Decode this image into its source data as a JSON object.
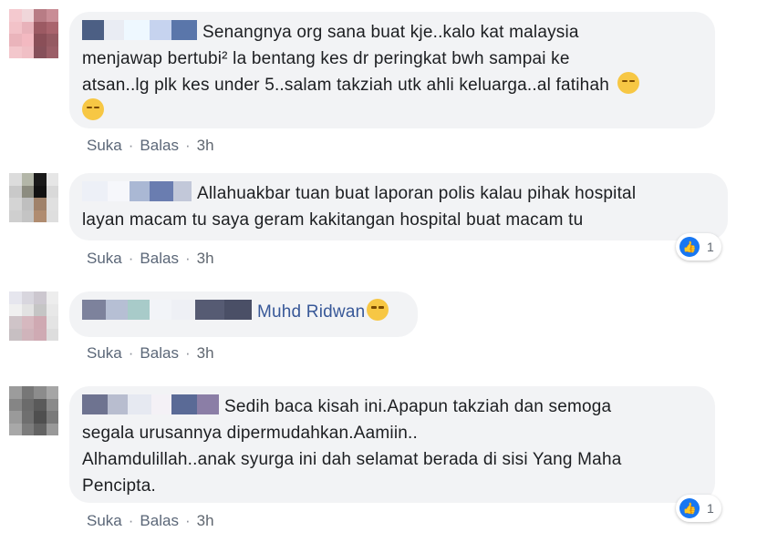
{
  "actions": {
    "like_label": "Suka",
    "reply_label": "Balas",
    "separator": "·"
  },
  "comments": [
    {
      "line1": "Senangnya org sana buat kje..kalo kat malaysia",
      "line2": "menjawap bertubi² la bentang kes dr peringkat bwh sampai ke",
      "line3": "atsan..lg plk kes under 5..salam takziah utk ahli keluarga..al fatihah",
      "time": "3h"
    },
    {
      "line1": "Allahuakbar tuan buat laporan polis kalau pihak hospital",
      "line2": "layan macam tu saya geram kakitangan hospital buat macam tu",
      "time": "3h",
      "reaction_count": "1"
    },
    {
      "line1": "Muhd Ridwan",
      "time": "3h"
    },
    {
      "line1": "Sedih baca kisah ini.Apapun takziah dan semoga",
      "line2": "segala urusannya dipermudahkan.Aamiin..",
      "line3": "Alhamdulillah..anak syurga ini dah selamat berada di sisi Yang Maha",
      "line4": "Pencipta.",
      "time": "3h",
      "reaction_count": "1"
    }
  ],
  "icons": {
    "emoji_pensive": "pensive-face-icon",
    "emoji_crying": "loudly-crying-face-icon",
    "like": "thumbs-up-icon"
  },
  "colors": {
    "bubble_bg": "#f2f3f5",
    "like_blue": "#1877f2",
    "action_text": "#606770"
  }
}
